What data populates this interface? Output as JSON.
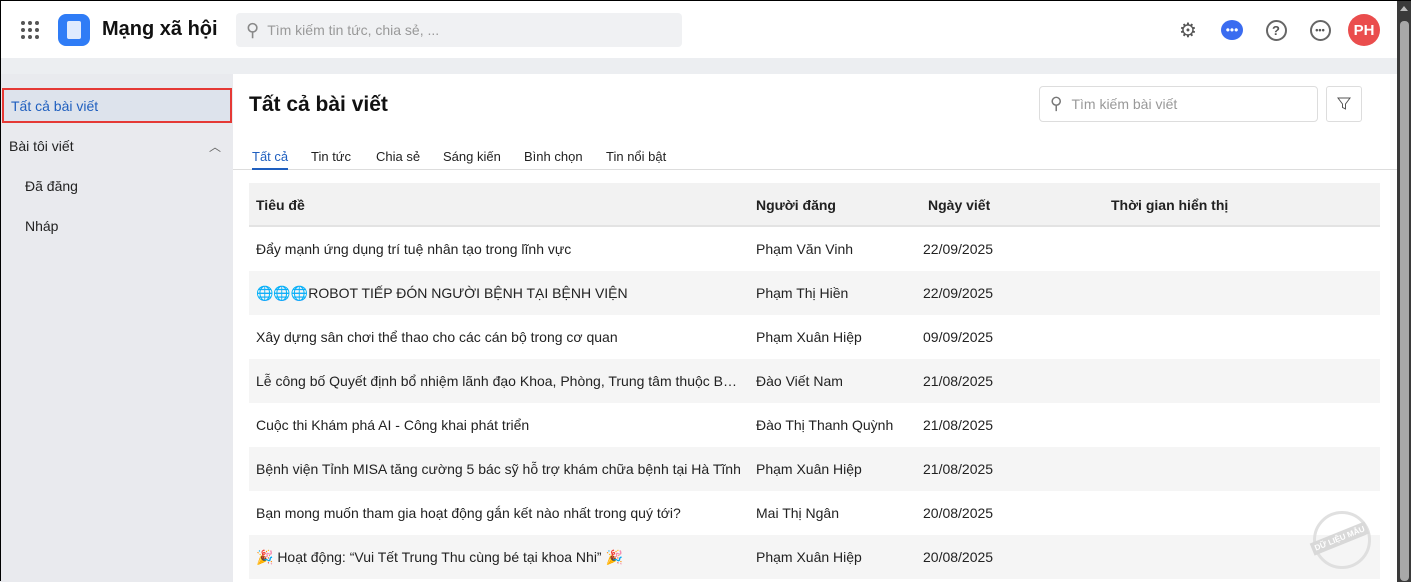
{
  "header": {
    "app_title": "Mạng xã hội",
    "search_placeholder": "Tìm kiếm tin tức, chia sẻ, ...",
    "avatar_initials": "PH"
  },
  "sidebar": {
    "active": "Tất cả bài viết",
    "group": "Bài tôi viết",
    "children": [
      "Đã đăng",
      "Nháp"
    ]
  },
  "main": {
    "title": "Tất cả bài viết",
    "search_placeholder": "Tìm kiếm bài viết",
    "tabs": [
      "Tất cả",
      "Tin tức",
      "Chia sẻ",
      "Sáng kiến",
      "Bình chọn",
      "Tin nổi bật"
    ],
    "columns": [
      "Tiêu đề",
      "Người đăng",
      "Ngày viết",
      "Thời gian hiển thị"
    ],
    "rows": [
      {
        "title": "Đẩy mạnh ứng dụng trí tuệ nhân tạo trong lĩnh vực",
        "author": "Phạm Văn Vinh",
        "date": "22/09/2025",
        "display": ""
      },
      {
        "title": "🌐🌐🌐ROBOT TIẾP ĐÓN NGƯỜI BỆNH TẠI BỆNH VIỆN",
        "author": "Phạm Thị Hiền",
        "date": "22/09/2025",
        "display": ""
      },
      {
        "title": "Xây dựng sân chơi thể thao cho các cán bộ trong cơ quan",
        "author": "Phạm Xuân Hiệp",
        "date": "09/09/2025",
        "display": ""
      },
      {
        "title": "Lễ công bố Quyết định bổ nhiệm lãnh đạo Khoa, Phòng, Trung tâm thuộc Bệ...",
        "author": "Đào Viết Nam",
        "date": "21/08/2025",
        "display": ""
      },
      {
        "title": "Cuộc thi Khám phá AI - Công khai phát triển",
        "author": "Đào Thị Thanh Quỳnh",
        "date": "21/08/2025",
        "display": ""
      },
      {
        "title": "Bệnh viện Tỉnh MISA tăng cường 5 bác sỹ hỗ trợ khám chữa bệnh tại Hà Tĩnh",
        "author": "Phạm Xuân Hiệp",
        "date": "21/08/2025",
        "display": ""
      },
      {
        "title": "Bạn mong muốn tham gia hoạt động gắn kết nào nhất trong quý tới?",
        "author": "Mai Thị Ngân",
        "date": "20/08/2025",
        "display": ""
      },
      {
        "title": "🎉 Hoạt động: “Vui Tết Trung Thu cùng bé tại khoa Nhi” 🎉",
        "author": "Phạm Xuân Hiệp",
        "date": "20/08/2025",
        "display": ""
      }
    ]
  },
  "watermark": "DỮ LIỆU MẪU"
}
